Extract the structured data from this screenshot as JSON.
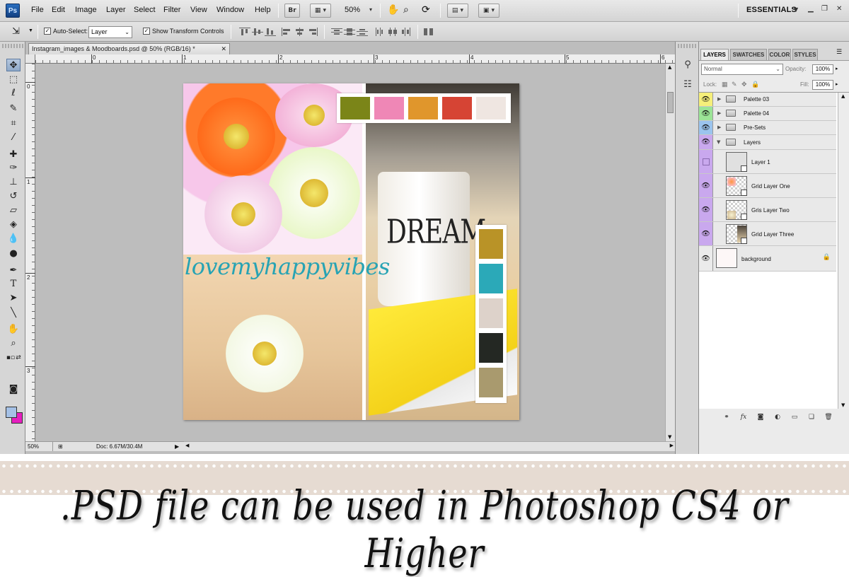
{
  "app": {
    "logo": "Ps",
    "menu": [
      "File",
      "Edit",
      "Image",
      "Layer",
      "Select",
      "Filter",
      "View",
      "Window",
      "Help"
    ],
    "bridge_button": "Br",
    "zoom": "50%",
    "workspace": "ESSENTIALS",
    "window_controls": [
      "minimize-icon",
      "restore-icon",
      "close-icon"
    ]
  },
  "options_bar": {
    "auto_select_label": "Auto-Select:",
    "auto_select_checked": true,
    "auto_select_value": "Layer",
    "transform_label": "Show Transform Controls",
    "transform_checked": true
  },
  "tools": [
    "move-tool-icon",
    "marquee-tool-icon",
    "lasso-tool-icon",
    "quick-select-tool-icon",
    "crop-tool-icon",
    "eyedropper-tool-icon",
    "healing-brush-tool-icon",
    "brush-tool-icon",
    "clone-stamp-tool-icon",
    "history-brush-tool-icon",
    "eraser-tool-icon",
    "paint-bucket-tool-icon",
    "blur-tool-icon",
    "dodge-tool-icon",
    "pen-tool-icon",
    "type-tool-icon",
    "path-select-tool-icon",
    "line-tool-icon",
    "hand-tool-icon",
    "zoom-tool-icon"
  ],
  "colors": {
    "foreground": "#a5c1e6",
    "background": "#e61ebf"
  },
  "document": {
    "tab_title": "Instagram_images & Moodboards.psd @ 50% (RGB/16) *",
    "ruler_h": [
      "0",
      "1",
      "2",
      "3",
      "4",
      "5",
      "6"
    ],
    "ruler_v": [
      "0",
      "1",
      "2",
      "3"
    ],
    "status_zoom": "50%",
    "status_doc": "Doc: 6.67M/30.4M"
  },
  "canvas": {
    "watermark": "lovemyhappyvibes",
    "mug_text": "DREAM",
    "palette_row": [
      "#7b8518",
      "#ef87b6",
      "#e0962c",
      "#d64434",
      "#efe6e1"
    ],
    "palette_col": [
      "#b99327",
      "#2ba9b8",
      "#ddd2ca",
      "#242823",
      "#a99a6e"
    ]
  },
  "layers_panel": {
    "tabs": [
      "LAYERS",
      "SWATCHES",
      "COLOR",
      "STYLES"
    ],
    "blend_mode": "Normal",
    "opacity_label": "Opacity:",
    "opacity": "100%",
    "lock_label": "Lock:",
    "fill_label": "Fill:",
    "fill": "100%",
    "layers": [
      {
        "name": "Palette 03",
        "type": "group",
        "label_color": "#f5ef7a"
      },
      {
        "name": "Palette 04",
        "type": "group",
        "label_color": "#9be496"
      },
      {
        "name": "Pre-Sets",
        "type": "group",
        "label_color": "#9bc4ee"
      },
      {
        "name": "Layers",
        "type": "group-open",
        "label_color": "#c9a8ee"
      },
      {
        "name": "Layer 1",
        "type": "smart",
        "label_color": "#c9a8ee"
      },
      {
        "name": "Grid Layer One",
        "type": "smart",
        "label_color": "#c9a8ee"
      },
      {
        "name": "Gris Layer Two",
        "type": "smart",
        "label_color": "#c9a8ee"
      },
      {
        "name": "Grid Layer Three",
        "type": "smart",
        "label_color": "#c9a8ee"
      },
      {
        "name": "background",
        "type": "locked",
        "label_color": "#ebebeb"
      }
    ]
  },
  "banner": {
    "text": ".PSD file can be used in Photoshop CS4 or Higher"
  }
}
